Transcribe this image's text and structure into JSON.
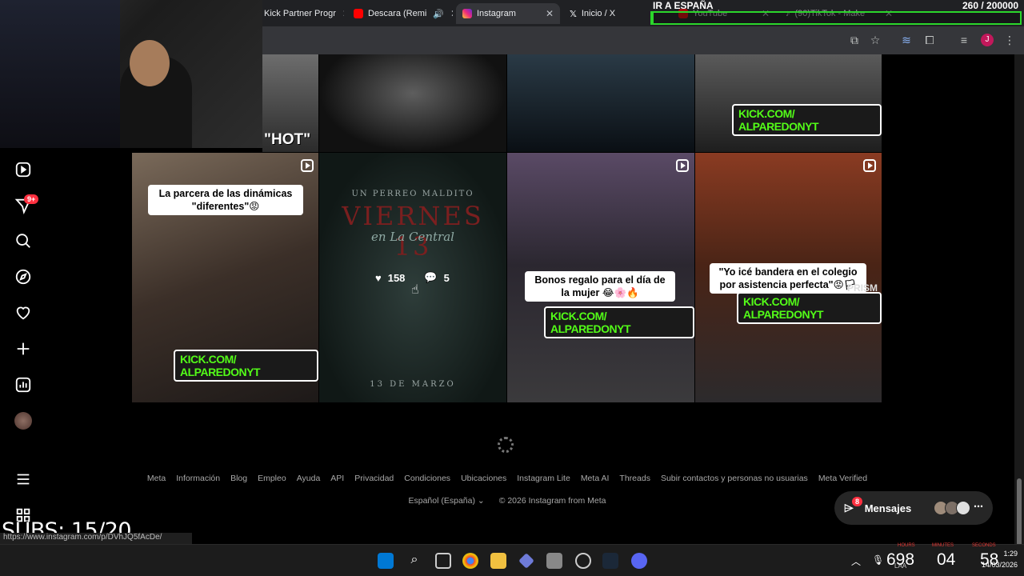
{
  "browser": {
    "tabs": [
      {
        "label": "Kick Partner Progr",
        "favicon_color": "#53fc18"
      },
      {
        "label": "Descara (Remi",
        "favicon_color": "#ff0000"
      },
      {
        "label": "Instagram",
        "favicon_color": "#e1306c",
        "active": true
      },
      {
        "label": "Inicio / X",
        "favicon_color": "#ffffff"
      },
      {
        "label": "YouTube",
        "favicon_color": "#ff0000"
      },
      {
        "label": "(90)TikTok - Make",
        "favicon_color": "#ffffff"
      }
    ],
    "profile_initial": "J"
  },
  "sidebar": {
    "notifications_badge": "9+"
  },
  "posts": [
    {
      "id": "top-1",
      "caption": "\"HOT\""
    },
    {
      "id": "top-4",
      "kick": "KICK.COM/ ALPAREDONYT"
    },
    {
      "id": "row-1",
      "caption": "La parcera de las dinámicas \"diferentes\"😡",
      "kick": "KICK.COM/ ALPAREDONYT"
    },
    {
      "id": "row-2",
      "poster_top": "UN PERREO MALDITO",
      "poster_main": "VIERNES 13",
      "poster_sub": "en La Central",
      "poster_date": "13 DE MARZO",
      "likes": "158",
      "comments": "5"
    },
    {
      "id": "row-3",
      "caption": "Bonos regalo para el día de la mujer 😂🌸🔥",
      "kick": "KICK.COM/ ALPAREDONYT"
    },
    {
      "id": "row-4",
      "caption": "\"Yo icé bandera en el colegio por asistencia perfecta\"😡🏳",
      "kick": "KICK.COM/ ALPAREDONYT",
      "watermark": "PRISM"
    }
  ],
  "footer": {
    "links": [
      "Meta",
      "Información",
      "Blog",
      "Empleo",
      "Ayuda",
      "API",
      "Privacidad",
      "Condiciones",
      "Ubicaciones",
      "Instagram Lite",
      "Meta AI",
      "Threads",
      "Subir contactos y personas no usuarias",
      "Meta Verified"
    ],
    "language": "Español (España)",
    "copyright": "© 2026 Instagram from Meta"
  },
  "messages": {
    "label": "Mensajes",
    "badge": "8"
  },
  "stream": {
    "subs": "SUBS: 15/20",
    "goal_title": "IR A ESPAÑA",
    "goal_count": "260 / 200000",
    "goal_progress": 0.0013,
    "timer_hours": "698",
    "timer_minutes": "04",
    "timer_seconds": "58",
    "timer_hours_label": "HOURS",
    "timer_minutes_label": "MINUTES",
    "timer_seconds_label": "SECONDS"
  },
  "status_url": "https://www.instagram.com/p/DVhJQ5fAcDe/",
  "system": {
    "time": "1:29",
    "date": "14/03/2026",
    "lang": "LAA"
  },
  "colors": {
    "kick_green": "#53fc18",
    "goal_green": "#2bd62b",
    "ig_red": "#ff3040"
  }
}
